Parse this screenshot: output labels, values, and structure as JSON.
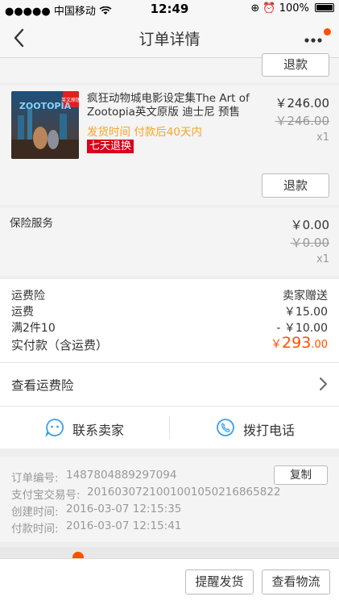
{
  "status_bar": {
    "carrier": "●●●●● 中国移动",
    "time": "12:49",
    "battery": "100%"
  },
  "nav": {
    "title": "订单详情"
  },
  "top_refund_button": "退款",
  "product": {
    "title": "疯狂动物城电影设定集The Art of Zootopia英文原版 迪士尼 预售",
    "shipping": "发货时间 付款后40天内",
    "badge": "七天退换",
    "price": "￥246.00",
    "original_price": "￥246.00",
    "quantity": "x1",
    "refund_button": "退款",
    "cover_text": "ZOOTOPIA",
    "cover_tag": "英文原版"
  },
  "insurance": {
    "label": "保险服务",
    "price": "￥0.00",
    "original_price": "￥0.00",
    "quantity": "x1"
  },
  "costs": {
    "shipping_insurance_label": "运费险",
    "shipping_insurance_value": "卖家赠送",
    "shipping_label": "运费",
    "shipping_value": "￥15.00",
    "discount_label": "满2件10",
    "discount_value": "- ￥10.00",
    "total_label": "实付款（含运费）",
    "total_currency": "￥",
    "total_int": "293",
    "total_dec": ".00"
  },
  "view_insurance": "查看运费险",
  "actions": {
    "contact_seller": "联系卖家",
    "call_phone": "拨打电话"
  },
  "order_info": {
    "order_no_label": "订单编号:",
    "order_no": "1487804889297094",
    "copy_button": "复制",
    "alipay_label": "支付宝交易号:",
    "alipay_no": "2016030721001001050216865822",
    "created_label": "创建时间:",
    "created": "2016-03-07 12:15:35",
    "paid_label": "付款时间:",
    "paid": "2016-03-07 12:15:41"
  },
  "bottom": {
    "remind_button": "提醒发货",
    "logistics_button": "查看物流"
  },
  "colors": {
    "accent": "#ff5000",
    "badge_red": "#d9001b",
    "ship_orange": "#f5a623",
    "icon_blue": "#3aa0e6"
  }
}
